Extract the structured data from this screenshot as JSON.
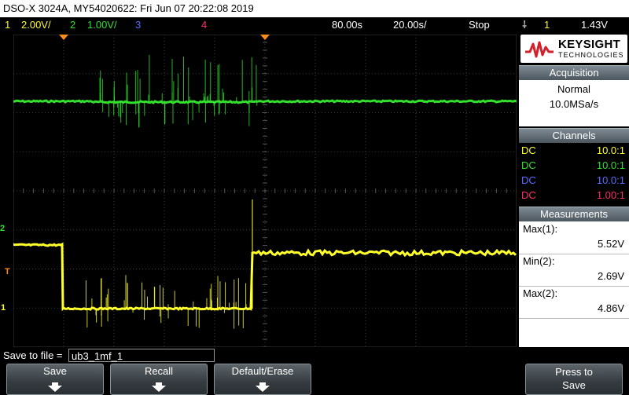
{
  "title": "DSO-X 3024A, MY54020622: Fri Jun 07 20:22:08 2019",
  "status": {
    "ch1_num": "1",
    "ch1_scale": "2.00V/",
    "ch2_num": "2",
    "ch2_scale": "1.00V/",
    "ch3_num": "3",
    "ch4_num": "4",
    "time_delay": "80.00s",
    "time_scale": "20.00s/",
    "run_state": "Stop",
    "trig_symbol": "⸸",
    "trig_source": "1",
    "trig_level": "1.43V"
  },
  "colors": {
    "ch1": "#ffff2b",
    "ch2": "#33e02e",
    "ch3": "#5a6cff",
    "ch4": "#ff2d6b",
    "trigger_marker": "#ff8c1a",
    "grid": "#3a3a3a"
  },
  "logo": {
    "brand": "KEYSIGHT",
    "sub": "TECHNOLOGIES"
  },
  "acquisition": {
    "header": "Acquisition",
    "mode": "Normal",
    "rate": "10.0MSa/s"
  },
  "channels": {
    "header": "Channels",
    "rows": [
      {
        "coupling": "DC",
        "ratio": "10.0:1"
      },
      {
        "coupling": "DC",
        "ratio": "10.0:1"
      },
      {
        "coupling": "DC",
        "ratio": "10.0:1"
      },
      {
        "coupling": "DC",
        "ratio": "1.00:1"
      }
    ]
  },
  "measurements": {
    "header": "Measurements",
    "items": [
      {
        "label": "Max(1):",
        "value": "5.52V"
      },
      {
        "label": "Min(2):",
        "value": "2.69V"
      },
      {
        "label": "Max(2):",
        "value": "4.86V"
      }
    ]
  },
  "markers": {
    "ch2_ground": "2",
    "trigger": "T",
    "ch1_ground": "1"
  },
  "save": {
    "label": "Save to file =",
    "filename": "ub3_1mf_1"
  },
  "softkeys": {
    "save": "Save",
    "recall": "Recall",
    "default": "Default/Erase",
    "press": "Press to",
    "press2": "Save"
  }
}
